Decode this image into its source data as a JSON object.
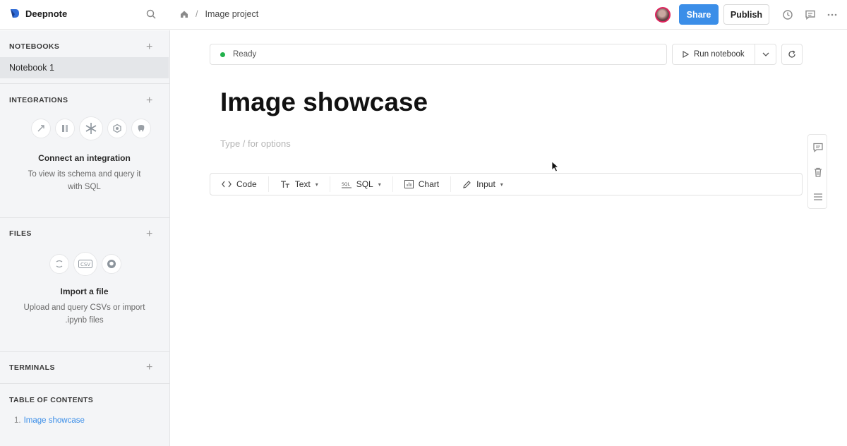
{
  "app": {
    "name": "Deepnote"
  },
  "breadcrumb": {
    "project": "Image project",
    "separator": "/"
  },
  "header": {
    "share_label": "Share",
    "publish_label": "Publish"
  },
  "sidebar": {
    "notebooks": {
      "heading": "NOTEBOOKS",
      "items": [
        {
          "label": "Notebook 1"
        }
      ]
    },
    "integrations": {
      "heading": "INTEGRATIONS",
      "title": "Connect an integration",
      "description": "To view its schema and query it with SQL",
      "icons": [
        "bigquery-icon",
        "redshift-icon",
        "snowflake-icon",
        "gcp-icon",
        "postgres-icon"
      ]
    },
    "files": {
      "heading": "FILES",
      "title": "Import a file",
      "description": "Upload and query CSVs or import .ipynb files",
      "icons": [
        "notebook-file-icon",
        "csv-icon",
        "github-icon"
      ]
    },
    "terminals": {
      "heading": "TERMINALS"
    },
    "toc": {
      "heading": "TABLE OF CONTENTS",
      "items": [
        {
          "num": "1.",
          "label": "Image showcase"
        }
      ]
    }
  },
  "status": {
    "text": "Ready",
    "color": "#22b14c"
  },
  "toolbar": {
    "run_label": "Run notebook"
  },
  "notebook": {
    "title": "Image showcase",
    "placeholder": "Type / for options"
  },
  "block_bar": {
    "items": [
      {
        "label": "Code",
        "icon": "code-icon",
        "dropdown": false
      },
      {
        "label": "Text",
        "icon": "text-icon",
        "dropdown": true
      },
      {
        "label": "SQL",
        "icon": "sql-icon",
        "dropdown": true
      },
      {
        "label": "Chart",
        "icon": "chart-icon",
        "dropdown": false
      },
      {
        "label": "Input",
        "icon": "pencil-icon",
        "dropdown": true
      }
    ]
  },
  "colors": {
    "accent": "#3b8ee8",
    "sidebar_bg": "#f4f5f7"
  }
}
